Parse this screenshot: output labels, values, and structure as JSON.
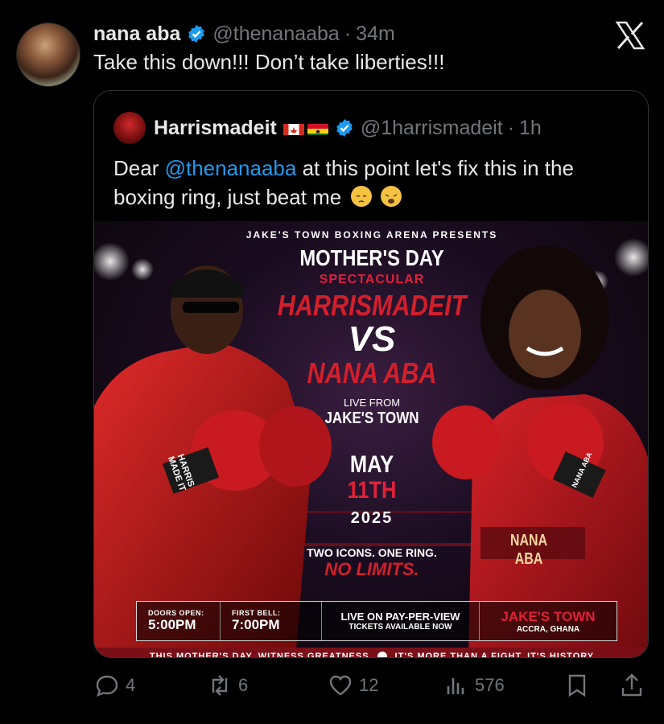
{
  "tweet": {
    "author_name": "nana aba",
    "handle": "@thenanaaba",
    "separator": "·",
    "time": "34m",
    "text": "Take this down!!! Don’t take liberties!!!"
  },
  "quoted": {
    "author_name": "Harrismadeit",
    "handle": "@1harrismadeit",
    "separator": "·",
    "time": "1h",
    "text_before": "Dear ",
    "mention": "@thenanaaba",
    "text_after": " at this point let's fix this in the boxing ring, just beat me"
  },
  "poster": {
    "presents": "JAKE'S TOWN BOXING ARENA PRESENTS",
    "title": "MOTHER'S DAY",
    "subtitle": "SPECTACULAR",
    "fighter_one": "HARRISMADEIT",
    "vs": "VS",
    "fighter_two": "NANA ABA",
    "live_from": "LIVE FROM",
    "venue": "JAKE'S TOWN",
    "month": "MAY",
    "day": "11TH",
    "year": "2025",
    "tagline": "TWO ICONS. ONE RING.",
    "tagline_2": "NO LIMITS.",
    "trunks_text": "NANA ABA",
    "glove_left": "HARRIS MADE IT",
    "glove_right": "NANA ABA",
    "doors_label": "DOORS OPEN:",
    "doors_time": "5:00PM",
    "bell_label": "FIRST BELL:",
    "bell_time": "7:00PM",
    "ppv": "LIVE ON PAY-PER-VIEW",
    "tickets": "TICKETS AVAILABLE NOW",
    "location_name": "JAKE'S TOWN",
    "location_city": "ACCRA, GHANA",
    "footer_left": "THIS MOTHER'S DAY, WITNESS GREATNESS",
    "footer_right": "IT'S MORE THAN A FIGHT. IT'S HISTORY"
  },
  "actions": {
    "replies": "4",
    "reposts": "6",
    "likes": "12",
    "views": "576"
  },
  "colors": {
    "verified": "#1d9bf0",
    "muted": "#71767b",
    "link": "#1d9bf0",
    "poster_red": "#d21f2b"
  },
  "icons": [
    "verified-icon",
    "x-logo-icon",
    "canada-flag-icon",
    "ghana-flag-icon",
    "pensive-emoji-icon",
    "weary-emoji-icon",
    "reply-icon",
    "repost-icon",
    "like-icon",
    "views-icon",
    "bookmark-icon",
    "share-icon"
  ]
}
